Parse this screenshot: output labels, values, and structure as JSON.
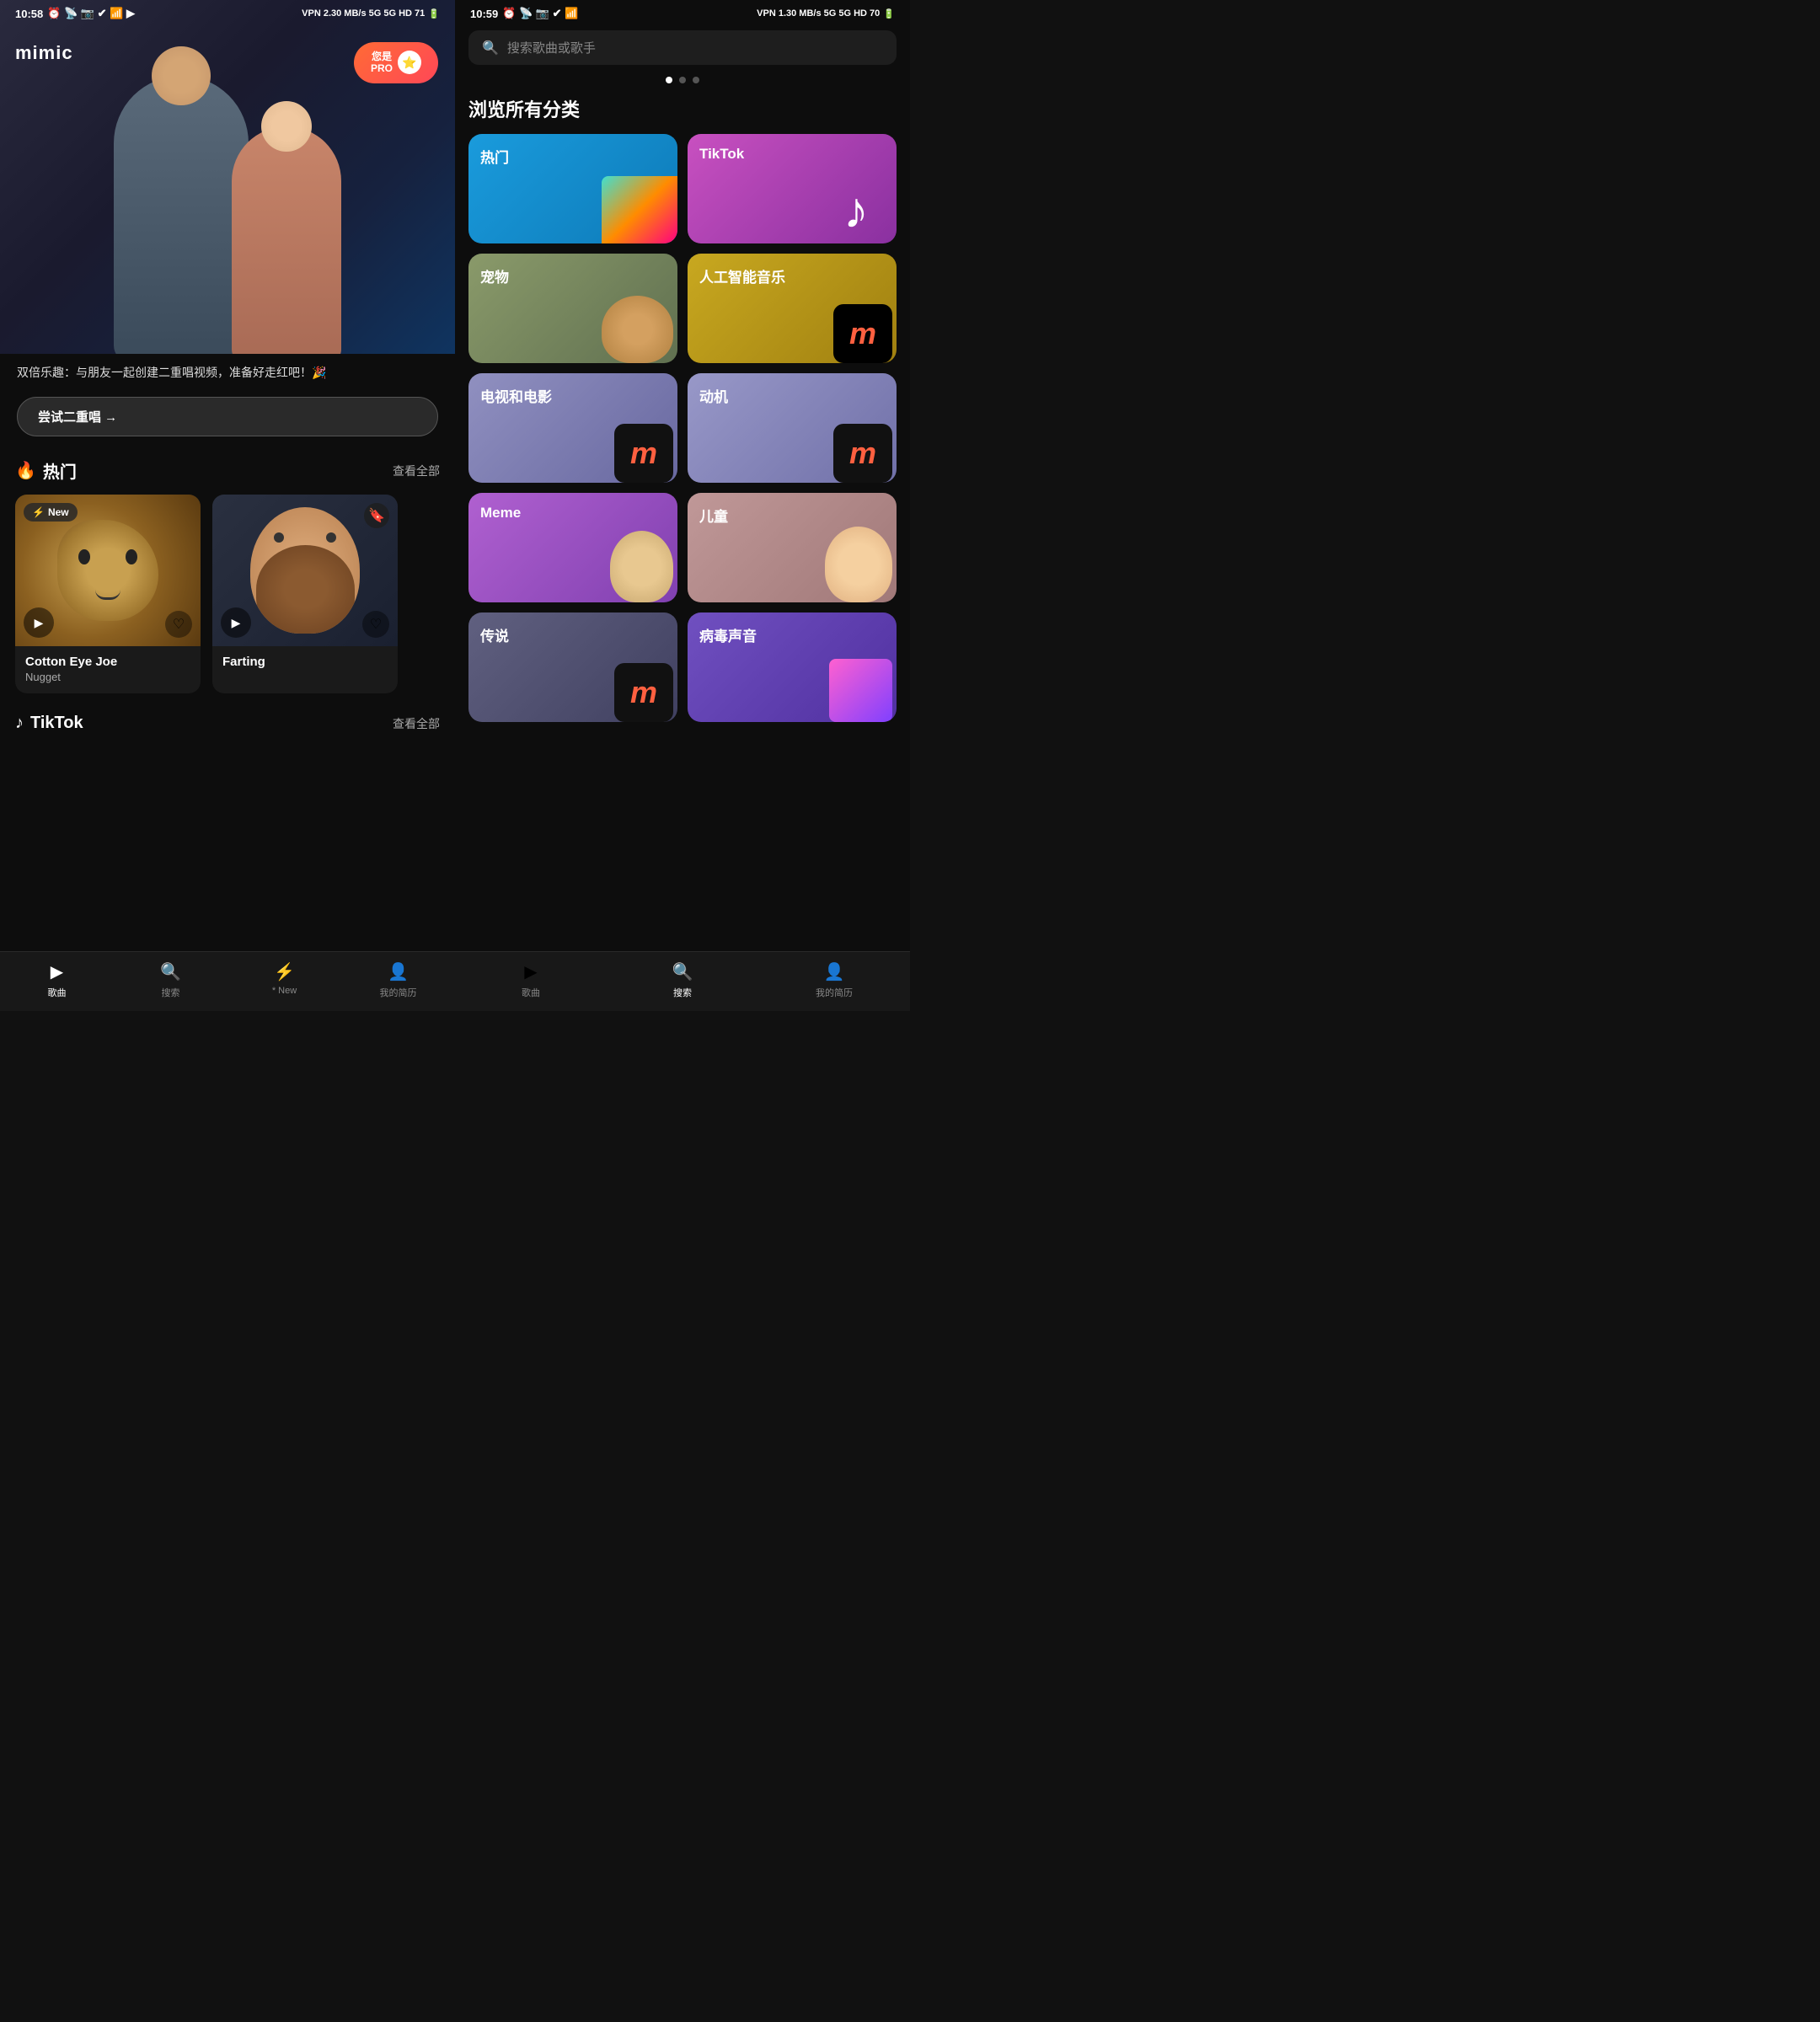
{
  "left": {
    "status": {
      "time": "10:58",
      "right_info": "VPN 2.30 MB/s 5G 5G HD 71"
    },
    "logo": "mimic",
    "pro_badge": {
      "line1": "您是",
      "line2": "PRO",
      "icon": "⭐"
    },
    "hero_description": "双倍乐趣：与朋友一起创建二重唱视频，准备好走红吧！🎉",
    "try_button": "尝试二重唱 →",
    "hot_section": {
      "title": "热门",
      "icon": "🔥",
      "see_all": "查看全部",
      "songs": [
        {
          "title": "Cotton Eye Joe",
          "artist": "Nugget",
          "badge": "⚡ New",
          "has_new_badge": true
        },
        {
          "title": "Farting",
          "artist": "",
          "has_new_badge": false
        }
      ]
    },
    "tiktok_section": {
      "title": "TikTok",
      "icon": "♪",
      "see_all": "查看全部"
    },
    "bottom_nav": [
      {
        "label": "歌曲",
        "icon": "▶",
        "active": true
      },
      {
        "label": "搜索",
        "icon": "🔍",
        "active": false
      },
      {
        "label": "* New",
        "icon": "⚡",
        "active": false
      },
      {
        "label": "我的简历",
        "icon": "👤",
        "active": false
      }
    ]
  },
  "right": {
    "status": {
      "time": "10:59",
      "right_info": "VPN 1.30 MB/s 5G 5G HD 70"
    },
    "search": {
      "placeholder": "搜索歌曲或歌手"
    },
    "browse_title": "浏览所有分类",
    "categories": [
      {
        "label": "热门",
        "key": "cat-hot"
      },
      {
        "label": "TikTok",
        "key": "cat-tiktok"
      },
      {
        "label": "宠物",
        "key": "cat-pet"
      },
      {
        "label": "人工智能音乐",
        "key": "cat-ai"
      },
      {
        "label": "电视和电影",
        "key": "cat-tv"
      },
      {
        "label": "动机",
        "key": "cat-motion"
      },
      {
        "label": "Meme",
        "key": "cat-meme"
      },
      {
        "label": "儿童",
        "key": "cat-children"
      },
      {
        "label": "传说",
        "key": "cat-legend"
      },
      {
        "label": "病毒声音",
        "key": "cat-viral"
      }
    ],
    "bottom_nav": [
      {
        "label": "歌曲",
        "icon": "▶",
        "active": false
      },
      {
        "label": "搜索",
        "icon": "🔍",
        "active": true
      },
      {
        "label": "我的简历",
        "icon": "👤",
        "active": false
      }
    ]
  }
}
